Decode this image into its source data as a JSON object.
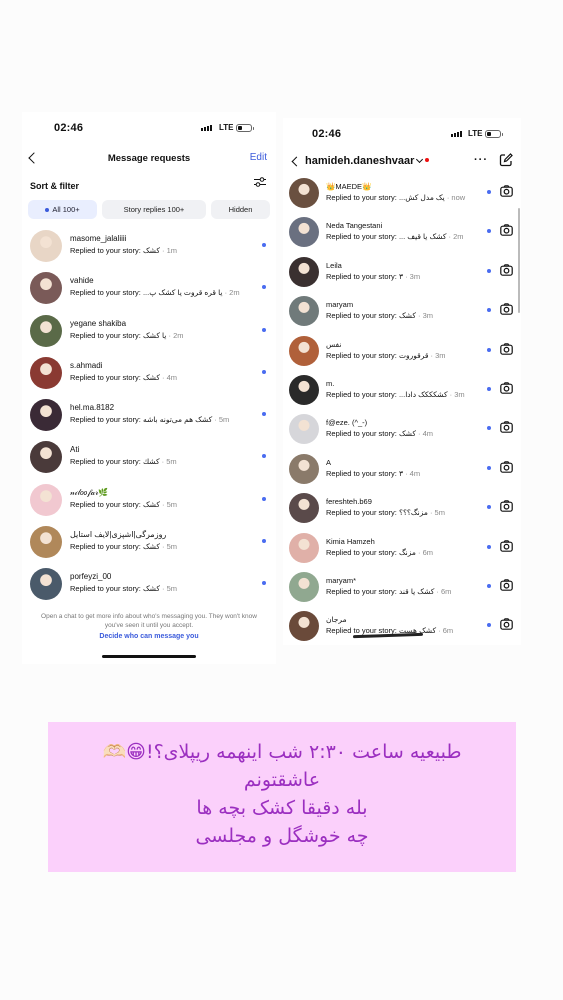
{
  "left_screen": {
    "status": {
      "time": "02:46",
      "network": "LTE"
    },
    "header": {
      "title": "Message requests",
      "edit": "Edit"
    },
    "sort_label": "Sort & filter",
    "filters": [
      {
        "label": "All 100+",
        "active": true
      },
      {
        "label": "Story replies 100+",
        "active": false
      },
      {
        "label": "Hidden",
        "active": false
      }
    ],
    "reply_prefix": "Replied to your story:",
    "rows": [
      {
        "name": "masome_jalaliiii",
        "message": "کشک",
        "time": "1m",
        "avatar_color": "#e8d6c6"
      },
      {
        "name": "vahide",
        "message": "یا قره قروت یا کشک پ...",
        "time": "2m",
        "avatar_color": "#7a5a58"
      },
      {
        "name": "yegane shakiba",
        "message": "یا کشک",
        "time": "2m",
        "avatar_color": "#5a6a48"
      },
      {
        "name": "s.ahmadi",
        "message": "کشک",
        "time": "4m",
        "avatar_color": "#8a3a32"
      },
      {
        "name": "hel.ma.8182",
        "message": "کشک هم می‌تونه باشه",
        "time": "5m",
        "avatar_color": "#3a2a36"
      },
      {
        "name": "Ati",
        "message": "کشك",
        "time": "5m",
        "avatar_color": "#4a3a3a"
      },
      {
        "name": "𝓃𝒾𝓁𝑜𝑜𝒻𝒶𝓇🌿",
        "message": "کشک",
        "time": "5m",
        "avatar_color": "#f1c8d0"
      },
      {
        "name": "روزمرگی|اشپزی|لایف استایل",
        "message": "کشک",
        "time": "5m",
        "avatar_color": "#b0885a"
      },
      {
        "name": "porfeyzi_00",
        "message": "کشک",
        "time": "5m",
        "avatar_color": "#4a5a6a"
      }
    ],
    "footer": {
      "note": "Open a chat to get more info about who's messaging you. They won't know you've seen it until you accept.",
      "link": "Decide who can message you"
    }
  },
  "right_screen": {
    "status": {
      "time": "02:46",
      "network": "LTE"
    },
    "header": {
      "username": "hamideh.daneshvaar",
      "more": "···"
    },
    "reply_prefix": "Replied to your story:",
    "rows": [
      {
        "name": "👑MAEDE👑",
        "message": "یک مدل کش...",
        "time": "now",
        "avatar_color": "#6a5040"
      },
      {
        "name": "Neda Tangestani",
        "message": "کشک یا قیف ...",
        "time": "2m",
        "avatar_color": "#6a7080"
      },
      {
        "name": "Leila",
        "message": "۳",
        "time": "3m",
        "avatar_color": "#3a3030"
      },
      {
        "name": "maryam",
        "message": "کشک",
        "time": "3m",
        "avatar_color": "#707a7a"
      },
      {
        "name": "نفس",
        "message": "قرقوروت",
        "time": "3m",
        "avatar_color": "#b0603a"
      },
      {
        "name": "m.",
        "message": "کشکککک دادا...",
        "time": "3m",
        "avatar_color": "#2a2a2a"
      },
      {
        "name": "f@eze. (^_-)",
        "message": "کشک",
        "time": "4m",
        "avatar_color": "#d6d6da"
      },
      {
        "name": "A",
        "message": "۳",
        "time": "4m",
        "avatar_color": "#8a7a6a"
      },
      {
        "name": "fereshteh.b69",
        "message": "مزنگ؟؟؟",
        "time": "5m",
        "avatar_color": "#5a4a4a"
      },
      {
        "name": "Kimia Hamzeh",
        "message": "مزنگ",
        "time": "6m",
        "avatar_color": "#e0b0a8"
      },
      {
        "name": "maryam*",
        "message": "کشک یا قند",
        "time": "6m",
        "avatar_color": "#90a890"
      },
      {
        "name": "مرجان",
        "message": "کشک هست",
        "time": "6m",
        "avatar_color": "#6a4a3a"
      }
    ]
  },
  "caption": {
    "line1": "طبیعیه ساعت ۲:۳۰ شب اینهمه ریپلای؟!😁🫶🏻",
    "line2": "عاشقتونم",
    "line3": "بله دقیقا کشک بچه ها",
    "line4": "چه خوشگل و مجلسی"
  }
}
